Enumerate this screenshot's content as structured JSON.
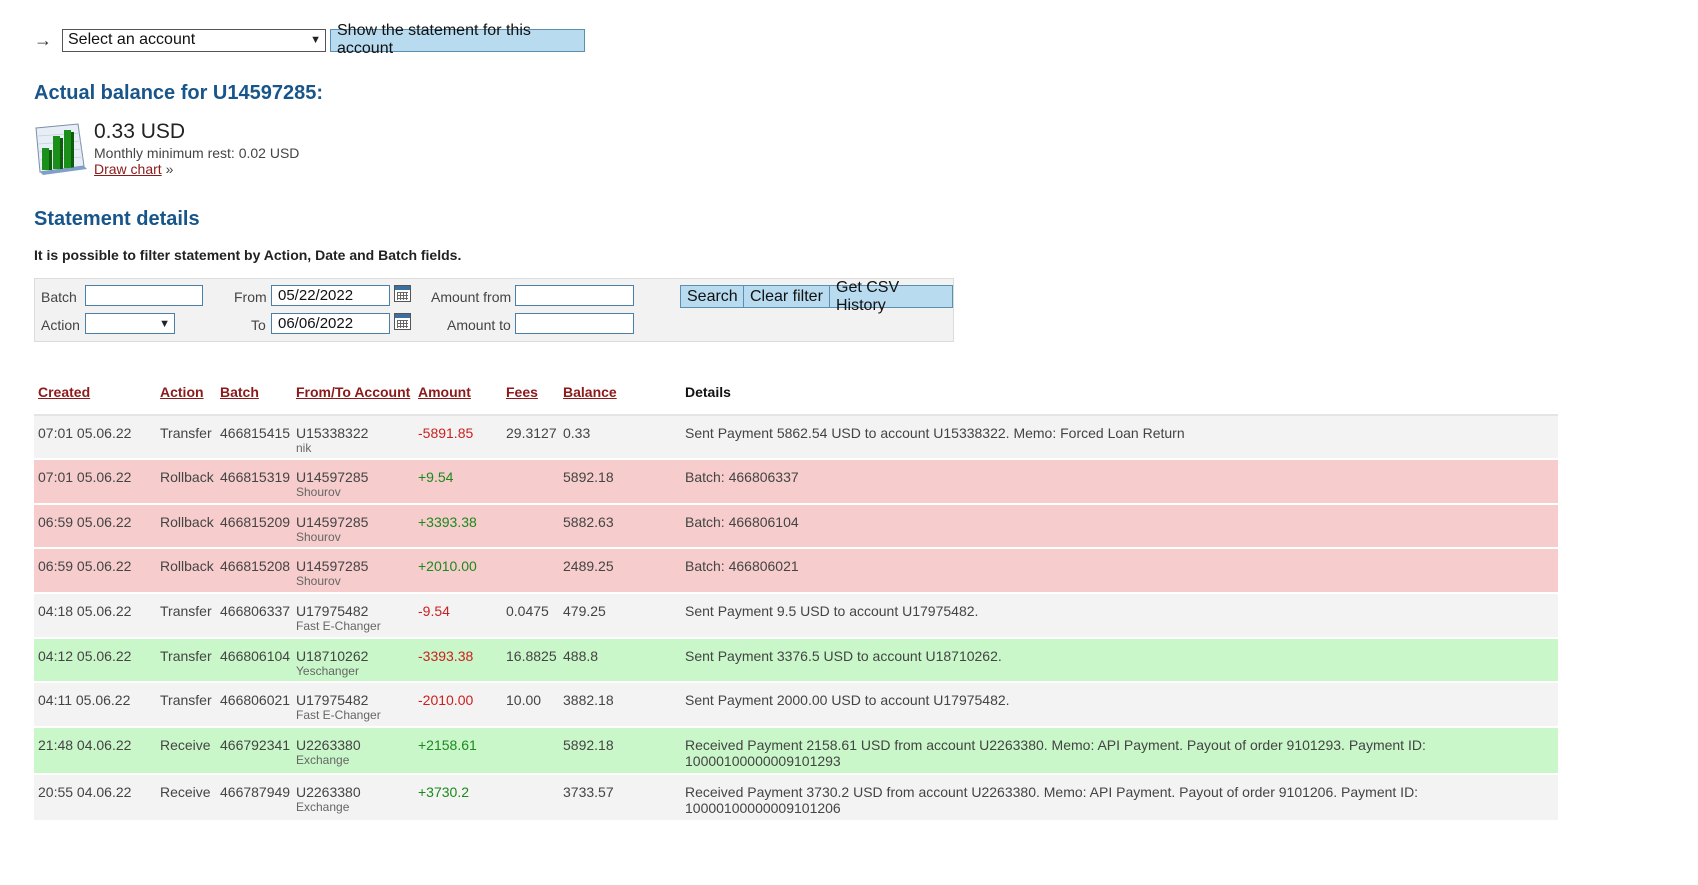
{
  "account_selector": {
    "arrow": "→",
    "select_value": "Select an account",
    "show_button": "Show the statement for this account"
  },
  "balance": {
    "title": "Actual balance for U14597285:",
    "amount": "0.33 USD",
    "minimum_rest": "Monthly minimum rest: 0.02 USD",
    "draw_chart_link": "Draw chart",
    "draw_chart_suffix": " »",
    "icon": "bar-chart-icon"
  },
  "statement": {
    "title": "Statement details",
    "filter_note": "It is possible to filter statement by Action, Date and Batch fields."
  },
  "filter": {
    "batch_label": "Batch",
    "batch_value": "",
    "action_label": "Action",
    "action_value": "",
    "from_label": "From",
    "from_value": "05/22/2022",
    "to_label": "To",
    "to_value": "06/06/2022",
    "amount_from_label": "Amount from",
    "amount_from_value": "",
    "amount_to_label": "Amount to",
    "amount_to_value": "",
    "search_button": "Search",
    "clear_button": "Clear filter",
    "csv_button": "Get CSV History"
  },
  "table": {
    "headers": {
      "created": "Created",
      "action": "Action",
      "batch": "Batch",
      "account": "From/To Account",
      "amount": "Amount",
      "fees": "Fees",
      "balance": "Balance",
      "details": "Details"
    },
    "rows": [
      {
        "created": "07:01 05.06.22",
        "action": "Transfer",
        "batch": "466815415",
        "account": "U15338322",
        "name": "nik",
        "amount": "-5891.85",
        "fees": "29.3127",
        "balance": "0.33",
        "details": "Sent Payment 5862.54 USD to account U15338322. Memo: Forced Loan Return",
        "status": "gray",
        "sign": "neg"
      },
      {
        "created": "07:01 05.06.22",
        "action": "Rollback",
        "batch": "466815319",
        "account": "U14597285",
        "name": "Shourov",
        "amount": "+9.54",
        "fees": "",
        "balance": "5892.18",
        "details": "Batch: 466806337",
        "status": "red",
        "sign": "pos"
      },
      {
        "created": "06:59 05.06.22",
        "action": "Rollback",
        "batch": "466815209",
        "account": "U14597285",
        "name": "Shourov",
        "amount": "+3393.38",
        "fees": "",
        "balance": "5882.63",
        "details": "Batch: 466806104",
        "status": "red",
        "sign": "pos"
      },
      {
        "created": "06:59 05.06.22",
        "action": "Rollback",
        "batch": "466815208",
        "account": "U14597285",
        "name": "Shourov",
        "amount": "+2010.00",
        "fees": "",
        "balance": "2489.25",
        "details": "Batch: 466806021",
        "status": "red",
        "sign": "pos"
      },
      {
        "created": "04:18 05.06.22",
        "action": "Transfer",
        "batch": "466806337",
        "account": "U17975482",
        "name": "Fast E-Changer",
        "amount": "-9.54",
        "fees": "0.0475",
        "balance": "479.25",
        "details": "Sent Payment 9.5 USD to account U17975482.",
        "status": "gray",
        "sign": "neg"
      },
      {
        "created": "04:12 05.06.22",
        "action": "Transfer",
        "batch": "466806104",
        "account": "U18710262",
        "name": "Yeschanger",
        "amount": "-3393.38",
        "fees": "16.8825",
        "balance": "488.8",
        "details": "Sent Payment 3376.5 USD to account U18710262.",
        "status": "green",
        "sign": "neg"
      },
      {
        "created": "04:11 05.06.22",
        "action": "Transfer",
        "batch": "466806021",
        "account": "U17975482",
        "name": "Fast E-Changer",
        "amount": "-2010.00",
        "fees": "10.00",
        "balance": "3882.18",
        "details": "Sent Payment 2000.00 USD to account U17975482.",
        "status": "gray",
        "sign": "neg"
      },
      {
        "created": "21:48 04.06.22",
        "action": "Receive",
        "batch": "466792341",
        "account": "U2263380",
        "name": "Exchange",
        "amount": "+2158.61",
        "fees": "",
        "balance": "5892.18",
        "details": "Received Payment 2158.61 USD from account U2263380. Memo: API Payment. Payout of order 9101293. Payment ID: 10000100000009101293",
        "status": "green",
        "sign": "pos"
      },
      {
        "created": "20:55 04.06.22",
        "action": "Receive",
        "batch": "466787949",
        "account": "U2263380",
        "name": "Exchange",
        "amount": "+3730.2",
        "fees": "",
        "balance": "3733.57",
        "details": "Received Payment 3730.2 USD from account U2263380. Memo: API Payment. Payout of order 9101206. Payment ID: 10000100000009101206",
        "status": "gray",
        "sign": "pos"
      }
    ]
  }
}
